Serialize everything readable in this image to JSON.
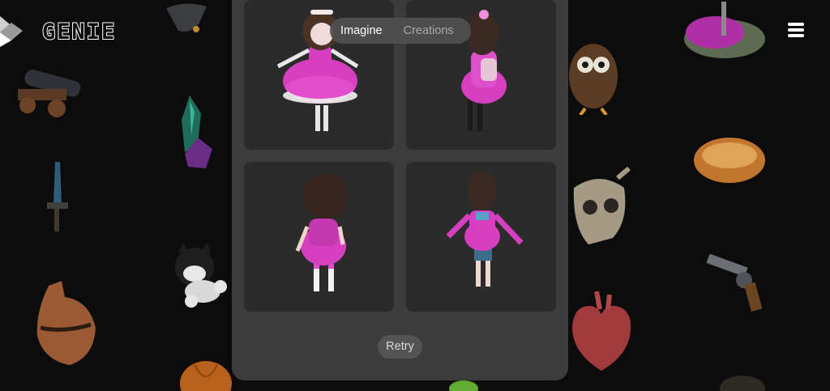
{
  "app": {
    "logo_text": "GENIE"
  },
  "tabs": [
    {
      "label": "Imagine",
      "active": true
    },
    {
      "label": "Creations",
      "active": false
    }
  ],
  "results": [
    {
      "name": "girl doll front view"
    },
    {
      "name": "girl doll side-back view"
    },
    {
      "name": "girl doll back view"
    },
    {
      "name": "girl doll T-pose back view"
    }
  ],
  "actions": {
    "retry_label": "Retry"
  },
  "colors": {
    "accent_pink": "#d63fbf",
    "panel": "#3d3c3c",
    "card": "#2b2b2b"
  },
  "icons": {
    "menu": "hamburger-menu-icon"
  }
}
